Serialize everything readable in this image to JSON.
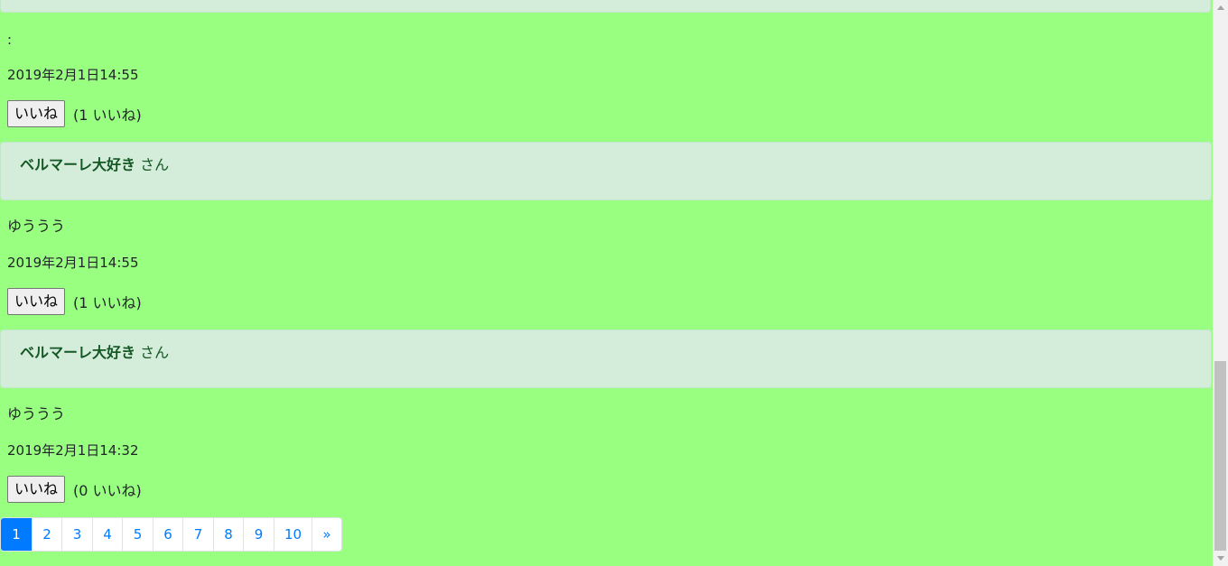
{
  "posts": [
    {
      "text": ":",
      "date": "2019年2月1日14:55",
      "like_label": "いいね",
      "like_count": "(1 いいね)"
    },
    {
      "author": "ベルマーレ大好き",
      "suffix": "さん",
      "text": "ゆううう",
      "date": "2019年2月1日14:55",
      "like_label": "いいね",
      "like_count": "(1 いいね)"
    },
    {
      "author": "ベルマーレ大好き",
      "suffix": "さん",
      "text": "ゆううう",
      "date": "2019年2月1日14:32",
      "like_label": "いいね",
      "like_count": "(0 いいね)"
    }
  ],
  "pagination": {
    "pages": [
      "1",
      "2",
      "3",
      "4",
      "5",
      "6",
      "7",
      "8",
      "9",
      "10"
    ],
    "next": "»",
    "active": "1"
  },
  "colors": {
    "background": "#99ff80",
    "alert_bg": "#d4edda",
    "alert_text": "#155724",
    "active_page": "#007bff"
  }
}
